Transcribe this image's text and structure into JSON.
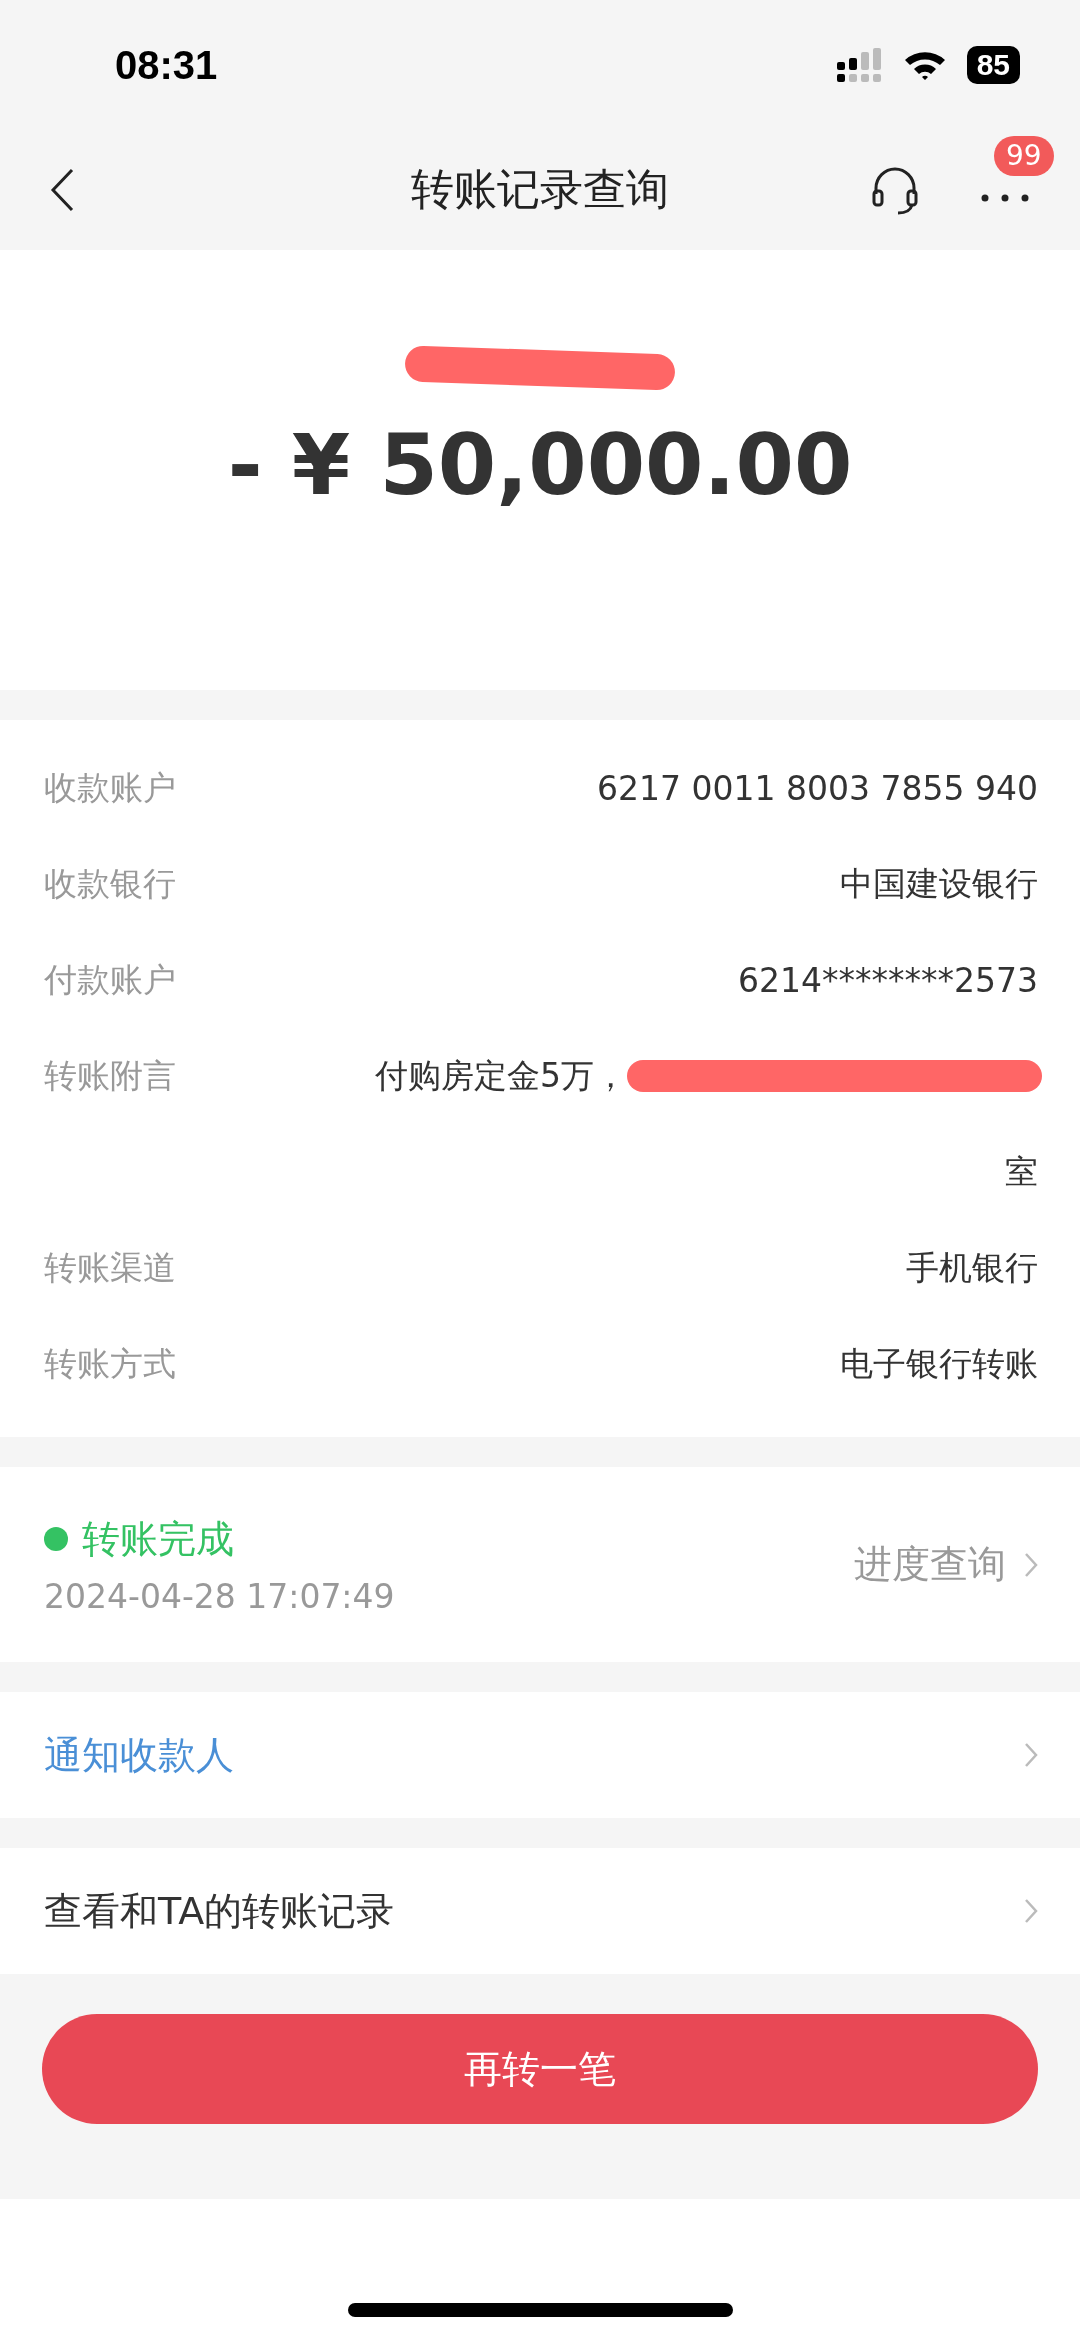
{
  "status_bar": {
    "time": "08:31",
    "battery": "85"
  },
  "nav": {
    "title": "转账记录查询",
    "badge": "99"
  },
  "summary": {
    "amount": "- ¥ 50,000.00"
  },
  "details": [
    {
      "label": "收款账户",
      "lines": [
        "6217 0011 8003 7855 940"
      ],
      "redacted": false
    },
    {
      "label": "收款银行",
      "lines": [
        "中国建设银行"
      ],
      "redacted": false
    },
    {
      "label": "付款账户",
      "lines": [
        "6214********2573"
      ],
      "redacted": false
    },
    {
      "label": "转账附言",
      "lines": [
        "付购房定金5万，",
        "室"
      ],
      "redacted": true
    },
    {
      "label": "转账渠道",
      "lines": [
        "手机银行"
      ],
      "redacted": false
    },
    {
      "label": "转账方式",
      "lines": [
        "电子银行转账"
      ],
      "redacted": false
    }
  ],
  "progress": {
    "status": "转账完成",
    "color": "#34c263",
    "time": "2024-04-28 17:07:49",
    "link": "进度查询"
  },
  "links": [
    {
      "label": "通知收款人",
      "kind": "accent"
    },
    {
      "label": "查看和TA的转账记录",
      "kind": "plain"
    }
  ],
  "button": "再转一笔"
}
